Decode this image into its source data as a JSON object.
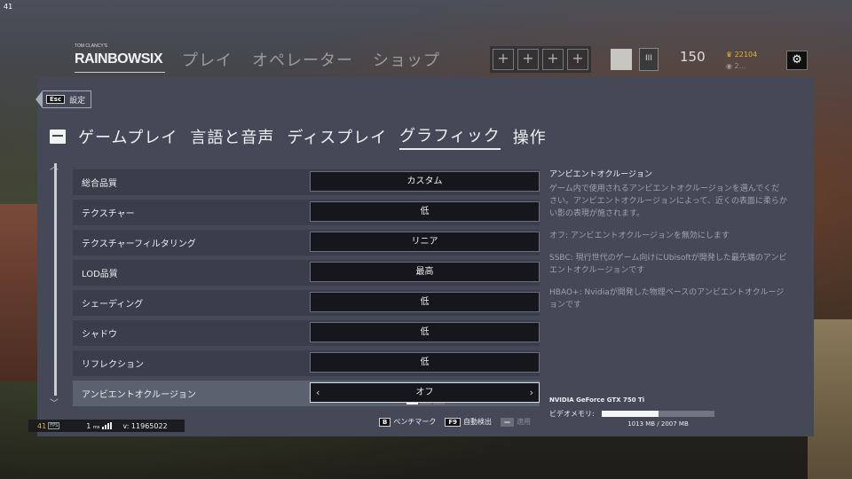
{
  "corner_fps": "41",
  "topbar": {
    "logo_sub": "TOM CLANCY'S",
    "logo": "RAINBOWSIX SIEGE",
    "nav": [
      "プレイ",
      "オペレーター",
      "ショップ"
    ],
    "squad_slots": [
      "+",
      "+",
      "+",
      "+"
    ],
    "level": "150",
    "renown": "22104",
    "credits": "2...",
    "settings_icon": "gear-icon"
  },
  "panel": {
    "esc_key": "Esc",
    "back_label": "設定",
    "tabs": [
      "ゲームプレイ",
      "言語と音声",
      "ディスプレイ",
      "グラフィック",
      "操作"
    ],
    "active_tab": "グラフィック",
    "rows": [
      {
        "label": "総合品質",
        "value": "カスタム"
      },
      {
        "label": "テクスチャー",
        "value": "低"
      },
      {
        "label": "テクスチャーフィルタリング",
        "value": "リニア"
      },
      {
        "label": "LOD品質",
        "value": "最高"
      },
      {
        "label": "シェーディング",
        "value": "低"
      },
      {
        "label": "シャドウ",
        "value": "低"
      },
      {
        "label": "リフレクション",
        "value": "低"
      },
      {
        "label": "アンビエントオクルージョン",
        "value": "オフ"
      }
    ],
    "selected_row": "アンビエントオクルージョン",
    "description": {
      "title": "アンビエントオクルージョン",
      "p1": "ゲーム内で使用されるアンビエントオクルージョンを選んでください。アンビエントオクルージョンによって、近くの表面に柔らかい影の表現が施されます。",
      "p2": "オフ: アンビエントオクルージョンを無効にします",
      "p3": "SSBC: 現行世代のゲーム向けにUbisoftが開発した最先端のアンビエントオクルージョンです",
      "p4": "HBAO+: Nvidiaが開発した物理ベースのアンビエントオクルージョンです"
    },
    "gpu": "NVIDIA GeForce GTX 750 Ti",
    "vram_label": "ビデオメモリ:",
    "vram_used_mb": 1013,
    "vram_total_mb": 2007,
    "vram_text": "1013 MB / 2007 MB",
    "buttons": [
      {
        "key": "B",
        "label": "ベンチマーク",
        "enabled": true
      },
      {
        "key": "F9",
        "label": "自動検出",
        "enabled": true
      },
      {
        "key": "—",
        "label": "適用",
        "enabled": false
      }
    ]
  },
  "status": {
    "fps": "41",
    "fps_tag": "FPS",
    "ping": "1",
    "ping_unit": "ms",
    "version": "v: 11965022"
  }
}
